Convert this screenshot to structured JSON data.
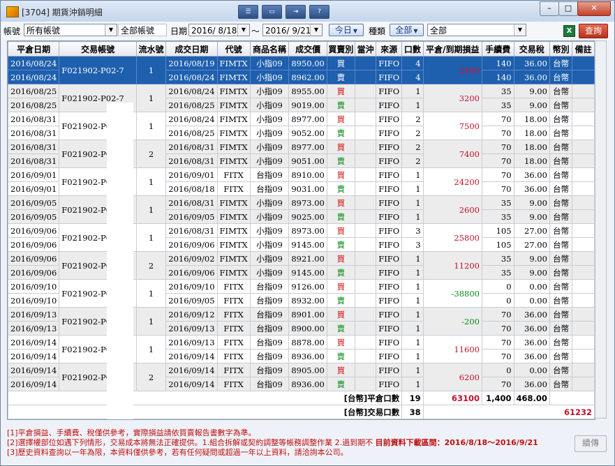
{
  "window": {
    "title": "[3704] 期貨沖銷明細",
    "toolbar_icons": [
      "list-icon",
      "window-icon",
      "export-icon",
      "help-icon"
    ],
    "help_label": "?"
  },
  "filters": {
    "account_label": "帳號",
    "account_value": "所有帳號",
    "account_all": "全部帳號",
    "date_label": "日期",
    "date_from": "2016/ 8/18",
    "date_sep": "〜",
    "date_to": "2016/ 9/21",
    "today_label": "今日",
    "type_label": "種類",
    "type_value": "全部",
    "product_value": "全部",
    "query_label": "查詢"
  },
  "table": {
    "columns": [
      "平倉日期",
      "交易帳號",
      "流水號",
      "成交日期",
      "代號",
      "商品名稱",
      "成交價",
      "買賣別",
      "當沖",
      "來源",
      "口數",
      "平倉/到期損益",
      "手續費",
      "交易稅",
      "幣別",
      "備註"
    ],
    "groups": [
      {
        "account": "F021902-P02-7",
        "seq": "1",
        "pnl": "2400",
        "pnl_sign": "pos",
        "selected": true,
        "rows": [
          {
            "close_date": "2016/08/24",
            "trade_date": "2016/08/19",
            "code": "FIMTX",
            "product": "小指09",
            "price": "8950.00",
            "side": "買",
            "dc": "",
            "source": "FIFO",
            "qty": "4",
            "fee": "140",
            "tax": "36.00",
            "currency": "台幣",
            "note": ""
          },
          {
            "close_date": "2016/08/24",
            "trade_date": "2016/08/24",
            "code": "FIMTX",
            "product": "小指09",
            "price": "8962.00",
            "side": "賣",
            "dc": "",
            "source": "FIFO",
            "qty": "4",
            "fee": "140",
            "tax": "36.00",
            "currency": "台幣",
            "note": ""
          }
        ]
      },
      {
        "account": "F021902-P02-7",
        "seq": "1",
        "pnl": "3200",
        "pnl_sign": "pos",
        "selected": false,
        "rows": [
          {
            "close_date": "2016/08/25",
            "trade_date": "2016/08/24",
            "code": "FIMTX",
            "product": "小指09",
            "price": "8955.00",
            "side": "買",
            "dc": "",
            "source": "FIFO",
            "qty": "1",
            "fee": "35",
            "tax": "9.00",
            "currency": "台幣",
            "note": ""
          },
          {
            "close_date": "2016/08/25",
            "trade_date": "2016/08/25",
            "code": "FIMTX",
            "product": "小指09",
            "price": "9019.00",
            "side": "賣",
            "dc": "",
            "source": "FIFO",
            "qty": "1",
            "fee": "35",
            "tax": "9.00",
            "currency": "台幣",
            "note": ""
          }
        ]
      },
      {
        "account": "F021902-P02-7",
        "seq": "1",
        "pnl": "7500",
        "pnl_sign": "pos",
        "selected": false,
        "rows": [
          {
            "close_date": "2016/08/31",
            "trade_date": "2016/08/24",
            "code": "FIMTX",
            "product": "小指09",
            "price": "8977.00",
            "side": "買",
            "dc": "",
            "source": "FIFO",
            "qty": "2",
            "fee": "70",
            "tax": "18.00",
            "currency": "台幣",
            "note": ""
          },
          {
            "close_date": "2016/08/31",
            "trade_date": "2016/08/25",
            "code": "FIMTX",
            "product": "小指09",
            "price": "9052.00",
            "side": "賣",
            "dc": "",
            "source": "FIFO",
            "qty": "2",
            "fee": "70",
            "tax": "18.00",
            "currency": "台幣",
            "note": ""
          }
        ]
      },
      {
        "account": "F021902-P02-7",
        "seq": "2",
        "pnl": "7400",
        "pnl_sign": "pos",
        "selected": false,
        "rows": [
          {
            "close_date": "2016/08/31",
            "trade_date": "2016/08/31",
            "code": "FIMTX",
            "product": "小指09",
            "price": "8977.00",
            "side": "買",
            "dc": "",
            "source": "FIFO",
            "qty": "2",
            "fee": "70",
            "tax": "18.00",
            "currency": "台幣",
            "note": ""
          },
          {
            "close_date": "2016/08/31",
            "trade_date": "2016/08/31",
            "code": "FIMTX",
            "product": "小指09",
            "price": "9051.00",
            "side": "賣",
            "dc": "",
            "source": "FIFO",
            "qty": "2",
            "fee": "70",
            "tax": "18.00",
            "currency": "台幣",
            "note": ""
          }
        ]
      },
      {
        "account": "F021902-P02-7",
        "seq": "1",
        "pnl": "24200",
        "pnl_sign": "pos",
        "selected": false,
        "rows": [
          {
            "close_date": "2016/09/01",
            "trade_date": "2016/09/01",
            "code": "FITX",
            "product": "台指09",
            "price": "8910.00",
            "side": "買",
            "dc": "",
            "source": "FIFO",
            "qty": "1",
            "fee": "70",
            "tax": "36.00",
            "currency": "台幣",
            "note": ""
          },
          {
            "close_date": "2016/09/01",
            "trade_date": "2016/08/18",
            "code": "FITX",
            "product": "台指09",
            "price": "9031.00",
            "side": "賣",
            "dc": "",
            "source": "FIFO",
            "qty": "1",
            "fee": "70",
            "tax": "36.00",
            "currency": "台幣",
            "note": ""
          }
        ]
      },
      {
        "account": "F021902-P02-7",
        "seq": "1",
        "pnl": "2600",
        "pnl_sign": "pos",
        "selected": false,
        "rows": [
          {
            "close_date": "2016/09/05",
            "trade_date": "2016/08/31",
            "code": "FIMTX",
            "product": "小指09",
            "price": "8973.00",
            "side": "買",
            "dc": "",
            "source": "FIFO",
            "qty": "1",
            "fee": "35",
            "tax": "9.00",
            "currency": "台幣",
            "note": ""
          },
          {
            "close_date": "2016/09/05",
            "trade_date": "2016/09/05",
            "code": "FIMTX",
            "product": "小指09",
            "price": "9025.00",
            "side": "賣",
            "dc": "",
            "source": "FIFO",
            "qty": "1",
            "fee": "35",
            "tax": "9.00",
            "currency": "台幣",
            "note": ""
          }
        ]
      },
      {
        "account": "F021902-P02-7",
        "seq": "1",
        "pnl": "25800",
        "pnl_sign": "pos",
        "selected": false,
        "rows": [
          {
            "close_date": "2016/09/06",
            "trade_date": "2016/08/31",
            "code": "FIMTX",
            "product": "小指09",
            "price": "8973.00",
            "side": "買",
            "dc": "",
            "source": "FIFO",
            "qty": "3",
            "fee": "105",
            "tax": "27.00",
            "currency": "台幣",
            "note": ""
          },
          {
            "close_date": "2016/09/06",
            "trade_date": "2016/09/06",
            "code": "FIMTX",
            "product": "小指09",
            "price": "9145.00",
            "side": "賣",
            "dc": "",
            "source": "FIFO",
            "qty": "3",
            "fee": "105",
            "tax": "27.00",
            "currency": "台幣",
            "note": ""
          }
        ]
      },
      {
        "account": "F021902-P02-7",
        "seq": "2",
        "pnl": "11200",
        "pnl_sign": "pos",
        "selected": false,
        "rows": [
          {
            "close_date": "2016/09/06",
            "trade_date": "2016/09/02",
            "code": "FIMTX",
            "product": "小指09",
            "price": "8921.00",
            "side": "買",
            "dc": "",
            "source": "FIFO",
            "qty": "1",
            "fee": "35",
            "tax": "9.00",
            "currency": "台幣",
            "note": ""
          },
          {
            "close_date": "2016/09/06",
            "trade_date": "2016/09/06",
            "code": "FIMTX",
            "product": "小指09",
            "price": "9145.00",
            "side": "賣",
            "dc": "",
            "source": "FIFO",
            "qty": "1",
            "fee": "35",
            "tax": "9.00",
            "currency": "台幣",
            "note": ""
          }
        ]
      },
      {
        "account": "F021902-P02-7",
        "seq": "1",
        "pnl": "-38800",
        "pnl_sign": "neg",
        "selected": false,
        "rows": [
          {
            "close_date": "2016/09/10",
            "trade_date": "2016/09/10",
            "code": "FITX",
            "product": "台指09",
            "price": "9126.00",
            "side": "買",
            "dc": "",
            "source": "FIFO",
            "qty": "1",
            "fee": "0",
            "tax": "0.00",
            "currency": "台幣",
            "note": ""
          },
          {
            "close_date": "2016/09/10",
            "trade_date": "2016/09/05",
            "code": "FITX",
            "product": "台指09",
            "price": "8932.00",
            "side": "賣",
            "dc": "",
            "source": "FIFO",
            "qty": "1",
            "fee": "0",
            "tax": "0.00",
            "currency": "台幣",
            "note": ""
          }
        ]
      },
      {
        "account": "F021902-P02-7",
        "seq": "1",
        "pnl": "-200",
        "pnl_sign": "neg",
        "selected": false,
        "rows": [
          {
            "close_date": "2016/09/13",
            "trade_date": "2016/09/12",
            "code": "FITX",
            "product": "台指09",
            "price": "8901.00",
            "side": "買",
            "dc": "",
            "source": "FIFO",
            "qty": "1",
            "fee": "70",
            "tax": "36.00",
            "currency": "台幣",
            "note": ""
          },
          {
            "close_date": "2016/09/13",
            "trade_date": "2016/09/13",
            "code": "FITX",
            "product": "台指09",
            "price": "8900.00",
            "side": "賣",
            "dc": "",
            "source": "FIFO",
            "qty": "1",
            "fee": "70",
            "tax": "36.00",
            "currency": "台幣",
            "note": ""
          }
        ]
      },
      {
        "account": "F021902-P02-7",
        "seq": "1",
        "pnl": "11600",
        "pnl_sign": "pos",
        "selected": false,
        "rows": [
          {
            "close_date": "2016/09/14",
            "trade_date": "2016/09/13",
            "code": "FITX",
            "product": "台指09",
            "price": "8878.00",
            "side": "買",
            "dc": "",
            "source": "FIFO",
            "qty": "1",
            "fee": "70",
            "tax": "36.00",
            "currency": "台幣",
            "note": ""
          },
          {
            "close_date": "2016/09/14",
            "trade_date": "2016/09/14",
            "code": "FITX",
            "product": "台指09",
            "price": "8936.00",
            "side": "賣",
            "dc": "",
            "source": "FIFO",
            "qty": "1",
            "fee": "70",
            "tax": "36.00",
            "currency": "台幣",
            "note": ""
          }
        ]
      },
      {
        "account": "F021902-P02-7",
        "seq": "2",
        "pnl": "6200",
        "pnl_sign": "pos",
        "selected": false,
        "rows": [
          {
            "close_date": "2016/09/14",
            "trade_date": "2016/09/14",
            "code": "FITX",
            "product": "台指09",
            "price": "8905.00",
            "side": "買",
            "dc": "",
            "source": "FIFO",
            "qty": "1",
            "fee": "0",
            "tax": "0.00",
            "currency": "台幣",
            "note": ""
          },
          {
            "close_date": "2016/09/14",
            "trade_date": "2016/09/14",
            "code": "FITX",
            "product": "台指09",
            "price": "8936.00",
            "side": "賣",
            "dc": "",
            "source": "FIFO",
            "qty": "1",
            "fee": "70",
            "tax": "36.00",
            "currency": "台幣",
            "note": ""
          }
        ]
      }
    ],
    "summary": {
      "close_label": "[台幣]平倉口數",
      "close_qty": "19",
      "close_pnl": "63100",
      "close_fee": "1,400",
      "close_tax": "468.00",
      "trade_label": "[台幣]交易口數",
      "trade_qty": "38",
      "net_total": "61232"
    }
  },
  "notes": {
    "line1": "[1]平倉損益、手續費、稅僅供參考，實際損益請依買賣報告書數字為準。",
    "line2": "[2]選擇權部位如遇下列情形，交易成本將無法正確提供。1.組合拆解或契約調整等帳務調整作業 2.過到期不",
    "range_text": "目前資料下載區間：2016/8/18〜2016/9/21",
    "line3": "[3]歷史資料查詢以一年為限，本資料僅供參考，若有任何疑問或超過一年以上資料，請洽詢本公司。"
  },
  "continue_label": "續傳"
}
